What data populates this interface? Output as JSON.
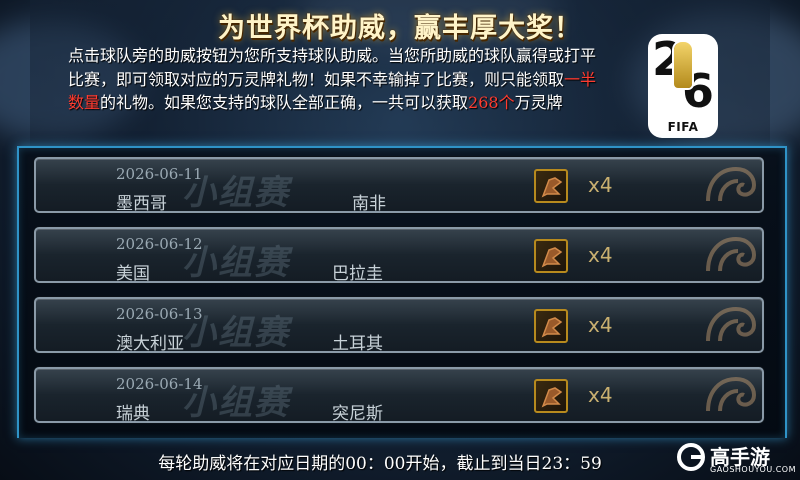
{
  "header": {
    "title": "为世界杯助威，赢丰厚大奖！",
    "desc_part1": "点击球队旁的助威按钮为您所支持球队助威。当您所助威的球队赢得或打平比赛，即可领取对应的万灵牌礼物！如果不幸输掉了比赛，则只能领取",
    "desc_highlight1": "一半数量",
    "desc_part2": "的礼物。如果您支持的球队全部正确，一共可以获取",
    "desc_highlight2": "268个",
    "desc_part3": "万灵牌",
    "highlight_color": "#ff3b2f"
  },
  "logo": {
    "digit_top": "2",
    "digit_bottom": "6",
    "text": "FIFA",
    "icon": "world-cup-trophy-icon"
  },
  "matches": [
    {
      "stage": "小组赛",
      "date": "2026-06-11",
      "team_a": "墨西哥",
      "team_b": "南非",
      "reward_count": "x4"
    },
    {
      "stage": "小组赛",
      "date": "2026-06-12",
      "team_a": "美国",
      "team_b": "巴拉圭",
      "reward_count": "x4"
    },
    {
      "stage": "小组赛",
      "date": "2026-06-13",
      "team_a": "澳大利亚",
      "team_b": "土耳其",
      "reward_count": "x4"
    },
    {
      "stage": "小组赛",
      "date": "2026-06-14",
      "team_a": "瑞典",
      "team_b": "突尼斯",
      "reward_count": "x4"
    }
  ],
  "footer": {
    "note": "每轮助威将在对应日期的00：00开始，截止到当日23：59"
  },
  "brand": {
    "name": "高手游",
    "url": "GAOSHOUYOU.COM"
  },
  "colors": {
    "frame_accent": "#2f93c7",
    "title_gold": "#fff4c8",
    "reward_text": "#c9b070"
  }
}
